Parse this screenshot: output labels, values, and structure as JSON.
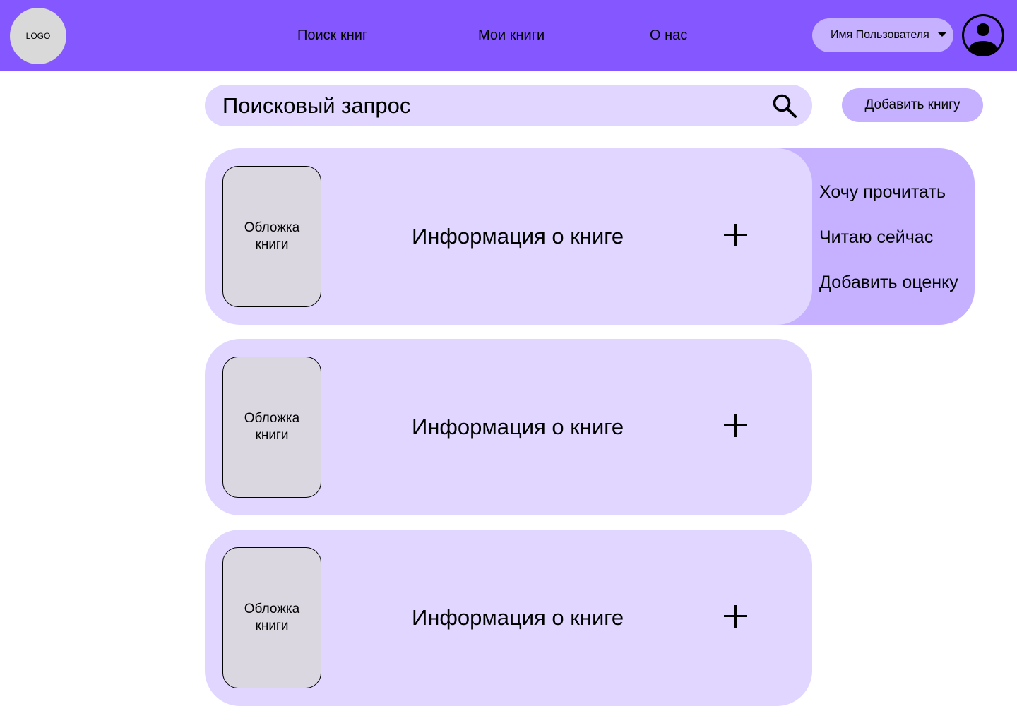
{
  "header": {
    "logo_text": "LOGO",
    "nav": {
      "search_books": "Поиск книг",
      "my_books": "Мои книги",
      "about": "О нас"
    },
    "user_name": "Имя Пользователя"
  },
  "search": {
    "placeholder": "Поисковый запрос"
  },
  "add_book_label": "Добавить книгу",
  "books": [
    {
      "cover": "Обложка книги",
      "info": "Информация о книге"
    },
    {
      "cover": "Обложка книги",
      "info": "Информация о книге"
    },
    {
      "cover": "Обложка книги",
      "info": "Информация о книге"
    }
  ],
  "action_menu": {
    "items": [
      "Хочу прочитать",
      "Читаю сейчас",
      "Добавить оценку"
    ]
  },
  "colors": {
    "header_bg": "#8557FF",
    "card_bg": "#E0D6FF",
    "accent_light": "#C5B1FF",
    "cover_bg": "#DAD7E1",
    "logo_bg": "#D9D9D9"
  }
}
